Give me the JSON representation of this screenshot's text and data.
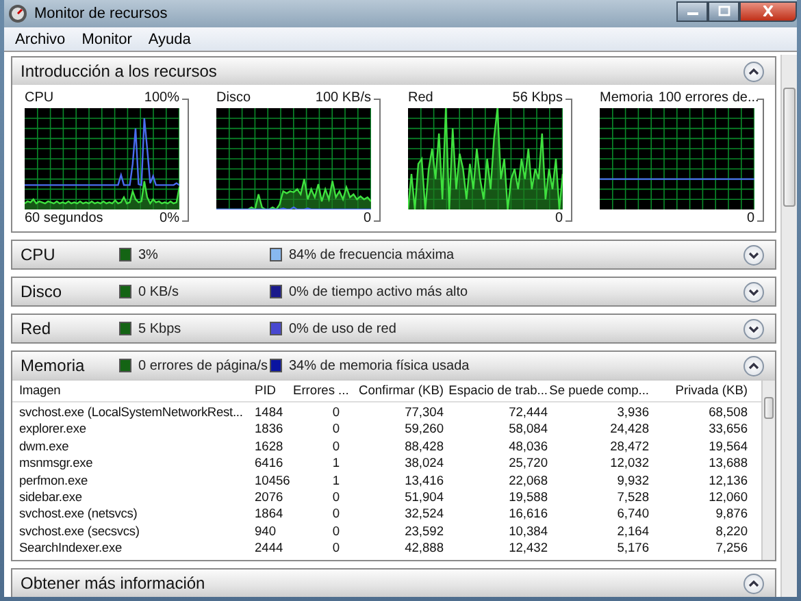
{
  "window": {
    "title": "Monitor de recursos"
  },
  "menu": [
    {
      "label": "Archivo"
    },
    {
      "label": "Monitor"
    },
    {
      "label": "Ayuda"
    }
  ],
  "overview": {
    "title": "Introducción a los recursos",
    "expanded": true,
    "graphs": [
      {
        "kind": "cpu",
        "title": "CPU",
        "scale": "100%",
        "time": "60 segundos",
        "minimum": "0%"
      },
      {
        "kind": "disk",
        "title": "Disco",
        "scale": "100 KB/s",
        "minimum": "0"
      },
      {
        "kind": "network",
        "title": "Red",
        "scale": "56 Kbps",
        "minimum": "0"
      },
      {
        "kind": "memory",
        "title": "Memoria",
        "scale": "100 errores de...",
        "minimum": "0"
      }
    ]
  },
  "sections": [
    {
      "title": "CPU",
      "expanded": false,
      "metrics": [
        {
          "text": "3%",
          "color": "#146414"
        },
        {
          "text": "84% de frecuencia máxima",
          "color": "#88b8f0"
        }
      ]
    },
    {
      "title": "Disco",
      "expanded": false,
      "metrics": [
        {
          "text": "0 KB/s",
          "color": "#146414"
        },
        {
          "text": "0% de tiempo activo más alto",
          "color": "#1a1a8c"
        }
      ]
    },
    {
      "title": "Red",
      "expanded": false,
      "metrics": [
        {
          "text": "5 Kbps",
          "color": "#146414"
        },
        {
          "text": "0% de uso de red",
          "color": "#4848d0"
        }
      ]
    },
    {
      "title": "Memoria",
      "expanded": true,
      "metrics": [
        {
          "text": "0 errores de página/s",
          "color": "#146414"
        },
        {
          "text": "34% de memoria física usada",
          "color": "#0a14a0"
        }
      ],
      "table": {
        "columns": [
          "Imagen",
          "PID",
          "Errores ...",
          "Confirmar (KB)",
          "Espacio de trab...",
          "Se puede comp...",
          "Privada (KB)"
        ],
        "rows": [
          [
            "svchost.exe (LocalSystemNetworkRest...",
            "1484",
            "0",
            "77,304",
            "72,444",
            "3,936",
            "68,508"
          ],
          [
            "explorer.exe",
            "1836",
            "0",
            "59,260",
            "58,084",
            "24,428",
            "33,656"
          ],
          [
            "dwm.exe",
            "1628",
            "0",
            "88,428",
            "48,036",
            "28,472",
            "19,564"
          ],
          [
            "msnmsgr.exe",
            "6416",
            "1",
            "38,024",
            "25,720",
            "12,032",
            "13,688"
          ],
          [
            "perfmon.exe",
            "10456",
            "1",
            "13,416",
            "22,068",
            "9,932",
            "12,136"
          ],
          [
            "sidebar.exe",
            "2076",
            "0",
            "51,904",
            "19,588",
            "7,528",
            "12,060"
          ],
          [
            "svchost.exe (netsvcs)",
            "1864",
            "0",
            "32,524",
            "16,616",
            "6,740",
            "9,876"
          ],
          [
            "svchost.exe (secsvcs)",
            "940",
            "0",
            "23,592",
            "10,384",
            "2,164",
            "8,220"
          ],
          [
            "SearchIndexer.exe",
            "2444",
            "0",
            "42,888",
            "12,432",
            "5,176",
            "7,256"
          ]
        ]
      }
    },
    {
      "title": "Obtener más información",
      "expanded": true
    }
  ]
}
